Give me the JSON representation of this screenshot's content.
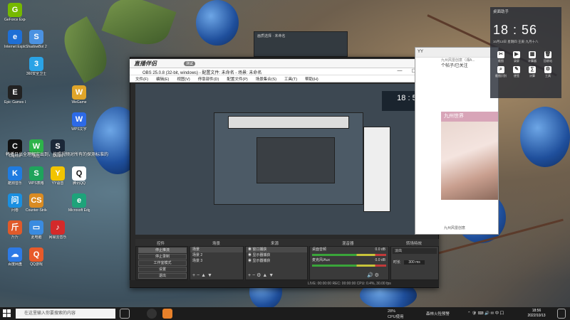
{
  "desktop": {
    "icons": [
      {
        "label": "GeForce Experience",
        "glyph": "G",
        "color": "#76b900",
        "icon": "geforce-icon"
      },
      {
        "label": "360安全卫士",
        "glyph": "3",
        "color": "#2aa3e6",
        "icon": "shield-icon"
      },
      {
        "label": "Internet Explorer",
        "glyph": "e",
        "color": "#1e6fd6",
        "icon": "browser-icon"
      },
      {
        "label": "ShadowBot 2020",
        "glyph": "S",
        "color": "#4b92e2",
        "icon": "bot-icon"
      },
      {
        "label": "Epic Games Launcher",
        "glyph": "E",
        "color": "#222",
        "icon": "epic-icon"
      },
      {
        "label": "CapCut",
        "glyph": "C",
        "color": "#111",
        "icon": "capcut-icon"
      },
      {
        "label": "微信",
        "glyph": "W",
        "color": "#2db34a",
        "icon": "wechat-icon"
      },
      {
        "label": "Steam",
        "glyph": "S",
        "color": "#1b2838",
        "icon": "steam-icon"
      },
      {
        "label": "WPS文字",
        "glyph": "W",
        "color": "#2d6ae6",
        "icon": "wps-icon"
      },
      {
        "label": "酷狗音乐",
        "glyph": "K",
        "color": "#1f7be0",
        "icon": "music-icon"
      },
      {
        "label": "WPS表格",
        "glyph": "S",
        "color": "#1fa35c",
        "icon": "spreadsheet-icon"
      },
      {
        "label": "YY语音",
        "glyph": "Y",
        "color": "#f2c400",
        "icon": "yy-icon"
      },
      {
        "label": "腾讯QQ",
        "glyph": "Q",
        "color": "#ffffff",
        "icon": "qq-icon"
      },
      {
        "label": "问卷",
        "glyph": "问",
        "color": "#1a8fe0",
        "icon": "form-icon"
      },
      {
        "label": "Counter-Strike Global",
        "glyph": "CS",
        "color": "#d98b22",
        "icon": "cs-icon"
      },
      {
        "label": "Microsoft Edge",
        "glyph": "e",
        "color": "#1ea37a",
        "icon": "edge-icon"
      },
      {
        "label": "斤斤",
        "glyph": "斤",
        "color": "#e05a2a",
        "icon": "app-icon"
      },
      {
        "label": "此电脑",
        "glyph": "▭",
        "color": "#3a8be0",
        "icon": "computer-icon"
      },
      {
        "label": "网易云音乐",
        "glyph": "♪",
        "color": "#d42a2a",
        "icon": "netease-icon"
      },
      {
        "label": "百度网盘",
        "glyph": "☁",
        "color": "#2d7ae6",
        "icon": "cloud-icon"
      },
      {
        "label": "QQ游戏",
        "glyph": "Q",
        "color": "#e85a2a",
        "icon": "game-icon"
      },
      {
        "label": "WeGame",
        "glyph": "W",
        "color": "#e0a52a",
        "icon": "wegame-icon"
      }
    ],
    "note": "韩播日出全理解实出到，按照视频对所有的探测标准的"
  },
  "small_window": {
    "title": "画质选择 · 未命名"
  },
  "logo": {
    "text": "直播伴侣",
    "badge": "测试"
  },
  "obs": {
    "title": "OBS 25.0.8 (32-bit, windows) - 配置文件: 未命名 - 场景: 未命名",
    "menu": [
      "文件(F)",
      "编辑(E)",
      "视图(V)",
      "停靠部件(D)",
      "配置文件(P)",
      "场景集合(S)",
      "工具(T)",
      "帮助(H)"
    ],
    "docks": {
      "controls": "控件",
      "scenes": "场景",
      "sources": "来源",
      "mixer": "混音器",
      "transitions": "转场特效"
    },
    "controls": [
      "停止推流",
      "停止录制",
      "工作室模式",
      "设置",
      "退出"
    ],
    "scenes": [
      "场景",
      "场景 2",
      "场景 3"
    ],
    "sources": [
      "窗口捕获",
      "显示器捕获",
      "显示器捕获"
    ],
    "mixer": [
      {
        "name": "桌面音频",
        "level": "0.0 dB"
      },
      {
        "name": "麦克风/Aux",
        "level": "0.0 dB"
      }
    ],
    "transition": {
      "type": "淡出",
      "duration_label": "时长",
      "duration": "300 ms"
    },
    "status": "LIVE: 00:00:00   REC: 00:00:00   CPU: 0.4%, 30.00 fps"
  },
  "chat": {
    "title": "YY",
    "subtitle": "九州风雷创意（湘A...",
    "line2": "个帖子/已关注",
    "banner": "九州世界",
    "footer": "九州风雷创意"
  },
  "widget": {
    "title": "桌面助手",
    "time": "18 : 56",
    "date": "10月13日  星期四  壬寅·九月十八",
    "items": [
      "截图",
      "录屏",
      "计算器",
      "回收站",
      "截图识别",
      "便签",
      "计算",
      "工具"
    ]
  },
  "taskbar": {
    "search_placeholder": "在这里输入你要搜索的内容",
    "cpu": "28%",
    "cpu_label": "CPU使用",
    "weather": "森林火险预警",
    "time": "18:56",
    "date": "2022/10/13"
  }
}
